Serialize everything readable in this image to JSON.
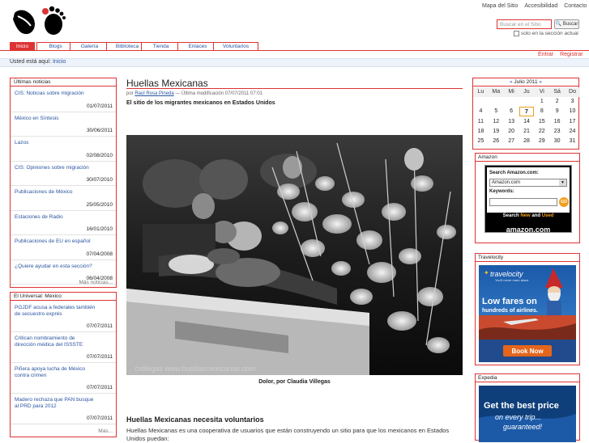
{
  "header": {
    "site_actions": [
      "Mapa del Sitio",
      "Accesibilidad",
      "Contacto"
    ],
    "search_placeholder": "Buscar en el Sitio",
    "search_button": "Buscar",
    "section_only_label": "solo en la sección actual"
  },
  "tabs": [
    {
      "label": "Inicio",
      "active": true
    },
    {
      "label": "Blogs",
      "active": false
    },
    {
      "label": "Galería",
      "active": false
    },
    {
      "label": "Biblioteca",
      "active": false
    },
    {
      "label": "Tienda",
      "active": false
    },
    {
      "label": "Enlaces",
      "active": false
    },
    {
      "label": "Voluntarios",
      "active": false
    }
  ],
  "login": {
    "enter": "Entrar",
    "register": "Registrar"
  },
  "breadcrumb": {
    "prefix": "Usted está aquí:",
    "current": "Inicio"
  },
  "ultimas_noticias": {
    "title": "Últimas noticias",
    "items": [
      {
        "title": "CIS: Noticias sobre migración",
        "date": "01/07/2011"
      },
      {
        "title": "México en Síntesis",
        "date": "30/06/2011"
      },
      {
        "title": "Lazos",
        "date": "02/08/2010"
      },
      {
        "title": "CIS: Opiniones sobre migración",
        "date": "30/07/2010"
      },
      {
        "title": "Publicaciones de México",
        "date": "25/05/2010"
      },
      {
        "title": "Estaciones de Radio",
        "date": "16/01/2010"
      },
      {
        "title": "Publicaciones de EU en español",
        "date": "07/04/2008"
      },
      {
        "title": "¿Quiere ayudar en esta sección?",
        "date": "06/04/2008"
      }
    ],
    "more": "Más noticias..."
  },
  "el_universal": {
    "title": "El Universal: México",
    "items": [
      {
        "title": "PGJDF acusa a federales también de secuestro exprés",
        "date": "07/07/2011"
      },
      {
        "title": "Critican nombramiento de dirección médica del ISSSTE",
        "date": "07/07/2011"
      },
      {
        "title": "Piñera apoya lucha de México contra crimen",
        "date": "07/07/2011"
      },
      {
        "title": "Madero rechaza que PAN busque al PRD para 2012",
        "date": "07/07/2011"
      }
    ],
    "more": "Más..."
  },
  "content": {
    "title": "Huellas Mexicanas",
    "byline_prefix": "por",
    "author": "Raúl Rosa Pineda",
    "byline_suffix": "— Última modificación 07/07/2011 07:01",
    "description": "El sitio de los migrantes mexicanos en Estados Unidos",
    "photo_watermark": "cvillegas  www.huellasmexicanas.com",
    "caption": "Dolor, por Claudia Villegas",
    "section_heading": "Huellas Mexicanas necesita voluntarios",
    "body_text": "Huellas Mexicanas es una cooperativa de usuarios que están construyendo un sitio para que los mexicanos en Estados Unidos puedan:"
  },
  "calendar": {
    "prev": "«",
    "month_label": "Julio 2011",
    "next": "»",
    "weekdays": [
      "Lu",
      "Ma",
      "Mi",
      "Ju",
      "Vi",
      "Sá",
      "Do"
    ],
    "today": 7,
    "weeks": [
      [
        "",
        "",
        "",
        "",
        "1",
        "2",
        "3"
      ],
      [
        "4",
        "5",
        "6",
        "7",
        "8",
        "9",
        "10"
      ],
      [
        "11",
        "12",
        "13",
        "14",
        "15",
        "16",
        "17"
      ],
      [
        "18",
        "19",
        "20",
        "21",
        "22",
        "23",
        "24"
      ],
      [
        "25",
        "26",
        "27",
        "28",
        "29",
        "30",
        "31"
      ]
    ]
  },
  "amazon": {
    "title": "Amazon",
    "search_label": "Search Amazon.com:",
    "store_option": "Amazon.com",
    "keywords_label": "Keywords:",
    "go": "GO",
    "promo_prefix": "Search",
    "promo_new": "New",
    "promo_and": "and",
    "promo_used": "Used",
    "logo": "amazon.com"
  },
  "travelocity": {
    "title": "Travelocity",
    "brand": "travelocity",
    "tagline": "You'll never roam alone",
    "headline1": "Low fares on",
    "headline2": "hundreds of airlines.",
    "cta": "Book Now"
  },
  "expedia": {
    "title": "Expedia",
    "line1": "Get the best price",
    "line2": "on every trip...",
    "line3": "guaranteed!"
  },
  "colors": {
    "accent": "#dd3333",
    "link": "#2a55a0",
    "amazon_orange": "#f0a020"
  }
}
